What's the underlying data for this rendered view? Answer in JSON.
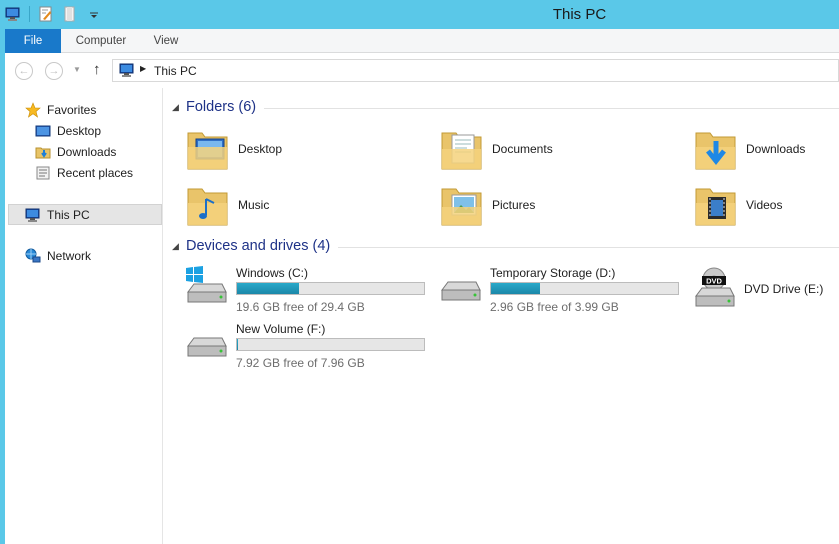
{
  "window": {
    "title": "This PC"
  },
  "ribbon": {
    "tabs": [
      {
        "label": "File"
      },
      {
        "label": "Computer"
      },
      {
        "label": "View"
      }
    ]
  },
  "address": {
    "path": "This PC"
  },
  "nav": {
    "favorites": "Favorites",
    "desktop": "Desktop",
    "downloads": "Downloads",
    "recent": "Recent places",
    "this_pc": "This PC",
    "network": "Network"
  },
  "folders": {
    "header": "Folders (6)",
    "items": [
      {
        "label": "Desktop",
        "icon": "folder-desktop-icon"
      },
      {
        "label": "Documents",
        "icon": "folder-documents-icon"
      },
      {
        "label": "Downloads",
        "icon": "folder-downloads-icon"
      },
      {
        "label": "Music",
        "icon": "folder-music-icon"
      },
      {
        "label": "Pictures",
        "icon": "folder-pictures-icon"
      },
      {
        "label": "Videos",
        "icon": "folder-videos-icon"
      }
    ]
  },
  "devices": {
    "header": "Devices and drives (4)",
    "items": [
      {
        "name": "Windows (C:)",
        "free": "19.6 GB free of 29.4 GB",
        "used_fraction": 0.33
      },
      {
        "name": "Temporary Storage (D:)",
        "free": "2.96 GB free of 3.99 GB",
        "used_fraction": 0.26
      },
      {
        "name": "DVD Drive (E:)",
        "dvd_label": "DVD"
      },
      {
        "name": "New Volume (F:)",
        "free": "7.92 GB free of 7.96 GB",
        "used_fraction": 0.005
      }
    ]
  },
  "colors": {
    "titlebar": "#5ac8e8",
    "file_tab": "#1979ca",
    "group_title": "#1e3287",
    "drive_bar": "#26a0da"
  }
}
